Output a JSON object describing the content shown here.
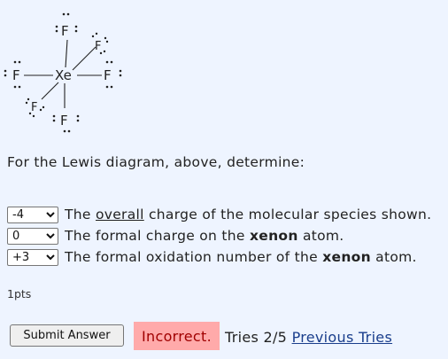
{
  "diagram": {
    "center_atom": "Xe",
    "ligand_atom": "F"
  },
  "question": {
    "prompt": "For the Lewis diagram, above, determine:"
  },
  "items": [
    {
      "selected": "-4",
      "text_before": "The ",
      "text_emph": "overall",
      "text_after": " charge of the molecular species shown.",
      "emph_style": "underline"
    },
    {
      "selected": "0",
      "text_before": "The formal charge on the ",
      "text_emph": "xenon",
      "text_after": " atom.",
      "emph_style": "bold"
    },
    {
      "selected": "+3",
      "text_before": "The formal oxidation number of the ",
      "text_emph": "xenon",
      "text_after": " atom.",
      "emph_style": "bold"
    }
  ],
  "points": "1pts",
  "submit_label": "Submit Answer",
  "status": {
    "text": "Incorrect.",
    "color": "#ffaaaa"
  },
  "tries": {
    "text": "Tries 2/5",
    "link": "Previous Tries"
  },
  "colors": {
    "background": "#eef4ff",
    "link": "#1a3e8c"
  }
}
